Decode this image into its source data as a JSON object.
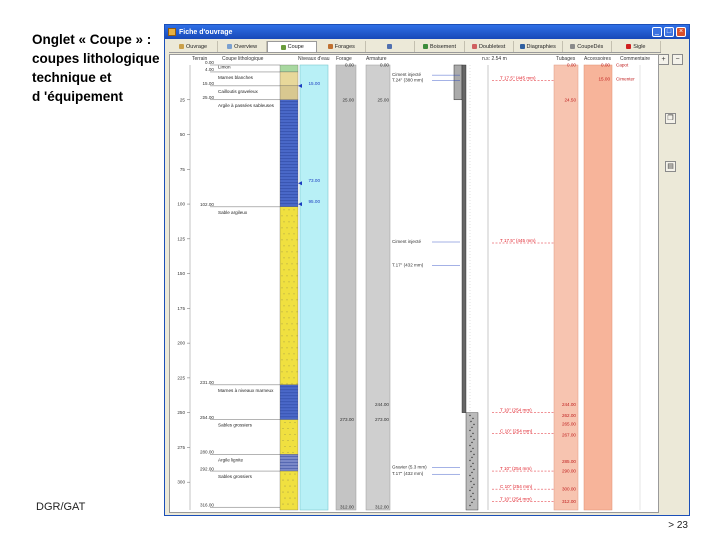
{
  "caption": {
    "lines": [
      "Onglet « Coupe » :",
      "coupes lithologique",
      "technique et",
      "d 'équipement"
    ]
  },
  "footer": {
    "left": "DGR/GAT",
    "right": "> 23"
  },
  "window": {
    "title": "Fiche d'ouvrage",
    "controls": [
      "minimize-icon",
      "maximize-icon",
      "close-icon"
    ],
    "tabs": [
      {
        "label": "Ouvrage",
        "icon": "folder-icon",
        "color": "#caa04a"
      },
      {
        "label": "Overview",
        "icon": "grid-icon",
        "color": "#7aa0d0"
      },
      {
        "label": "Coupe",
        "icon": "coupe-icon",
        "color": "#6a9c3c",
        "active": true
      },
      {
        "label": "Forages",
        "icon": "drill-icon",
        "color": "#c07030"
      },
      {
        "label": "",
        "icon": "table-icon",
        "color": "#5070b0"
      },
      {
        "label": "Boisement",
        "icon": "tree-icon",
        "color": "#3c8c3c"
      },
      {
        "label": "Doubletest",
        "icon": "chart-icon",
        "color": "#d06060"
      },
      {
        "label": "Diagraphies",
        "icon": "curve-icon",
        "color": "#3060a0"
      },
      {
        "label": "CoupeDés",
        "icon": "section-icon",
        "color": "#8a8a8a"
      },
      {
        "label": "Sigle",
        "icon": "plus-icon",
        "color": "#d02020"
      }
    ],
    "side_buttons": [
      "zoom-in-icon",
      "zoom-out-icon",
      "copy-icon",
      "print-icon"
    ]
  },
  "section": {
    "headers": {
      "terrain": "Terrain",
      "coupe": "Coupe lithologique",
      "niveau": "Niveaux d'eau",
      "forage": "Forage",
      "armature": "Armature",
      "nivel": "n.s: 2.54 m",
      "tubages": "Tubages",
      "accessoires": "Accessoires",
      "commentaire": "Commentaire"
    },
    "depth_max": 320,
    "depth_ticks": [
      25,
      50,
      75,
      100,
      125,
      150,
      175,
      200,
      225,
      250,
      275,
      300
    ],
    "layers": [
      {
        "from": 0,
        "to": 5,
        "label": "Limon",
        "fill": "#a8d8a0"
      },
      {
        "from": 5,
        "to": 15,
        "label": "Marnes blanches",
        "fill": "#e8d89a"
      },
      {
        "from": 15,
        "to": 25,
        "label": "Cailloutis graveleux",
        "fill": "#d8c890"
      },
      {
        "from": 25,
        "to": 102,
        "label": "Argile à passées sableuses",
        "fill": "#4a68c8"
      },
      {
        "from": 102,
        "to": 230,
        "label": "Sable argileux",
        "fill": "#f0e040"
      },
      {
        "from": 230,
        "to": 255,
        "label": "Marnes à niveaux marneux",
        "fill": "#4a68c8"
      },
      {
        "from": 255,
        "to": 280,
        "label": "Sables grossiers",
        "fill": "#f0e040"
      },
      {
        "from": 280,
        "to": 292,
        "label": "Argile lignite",
        "fill": "#7a88c8"
      },
      {
        "from": 292,
        "to": 320,
        "label": "Sables grossiers",
        "fill": "#f0e040"
      }
    ],
    "terrain_labels": [
      {
        "depth": 0,
        "text": "0.00"
      },
      {
        "depth": 5,
        "text": "4.00"
      },
      {
        "depth": 15,
        "text": "15.00"
      },
      {
        "depth": 25,
        "text": "25.00"
      },
      {
        "depth": 102,
        "text": "102.00"
      },
      {
        "depth": 230,
        "text": "231.00"
      },
      {
        "depth": 255,
        "text": "254.00"
      },
      {
        "depth": 280,
        "text": "280.00"
      },
      {
        "depth": 292,
        "text": "292.00"
      },
      {
        "depth": 318,
        "text": "316.00"
      }
    ],
    "water_levels": [
      {
        "depth": 15,
        "text": "15.00"
      },
      {
        "depth": 85,
        "text": "73.00"
      },
      {
        "depth": 100,
        "text": "95.00"
      }
    ],
    "forage_labels": [
      {
        "depth": 0,
        "text": "0.00"
      },
      {
        "depth": 25,
        "text": "25.00"
      },
      {
        "depth": 255,
        "text": "273.00"
      },
      {
        "depth": 318,
        "text": "312.00"
      }
    ],
    "armature_labels": [
      {
        "depth": 0,
        "text": "0.00"
      },
      {
        "depth": 25,
        "text": "25.00"
      },
      {
        "depth": 244,
        "text": "244.00"
      },
      {
        "depth": 255,
        "text": "273.00"
      },
      {
        "depth": 318,
        "text": "312.00"
      }
    ],
    "annotations": [
      {
        "depth": 8,
        "text": "Ciment injecté"
      },
      {
        "depth": 12,
        "text": "T.24\" (380 mm)"
      },
      {
        "depth": 128,
        "text": "Ciment injecté"
      },
      {
        "depth": 145,
        "text": "T.17\" (432 mm)"
      },
      {
        "depth": 290,
        "text": "Gravier (5.3 mm)"
      },
      {
        "depth": 295,
        "text": "T.17\" (432 mm)"
      }
    ],
    "red_labels": [
      {
        "depth": 11,
        "text": "T 17.5\" (445 mm)"
      },
      {
        "depth": 128,
        "text": "T 17.5\" (445 mm)"
      },
      {
        "depth": 250,
        "text": "T 10\" (254 mm)"
      },
      {
        "depth": 265,
        "text": "C 10\" (254 mm)"
      },
      {
        "depth": 292,
        "text": "T 10\" (254 mm)"
      },
      {
        "depth": 305,
        "text": "C 10\" (254 mm)"
      },
      {
        "depth": 314,
        "text": "T 10\" (254 mm)"
      }
    ],
    "tubage_labels": [
      {
        "depth": 0,
        "text": "0.00"
      },
      {
        "depth": 25,
        "text": "24.50"
      },
      {
        "depth": 244,
        "text": "244.00"
      },
      {
        "depth": 252,
        "text": "262.00"
      },
      {
        "depth": 258,
        "text": "265.00"
      },
      {
        "depth": 266,
        "text": "267.00"
      },
      {
        "depth": 285,
        "text": "285.00"
      },
      {
        "depth": 292,
        "text": "290.00"
      },
      {
        "depth": 305,
        "text": "300.00"
      },
      {
        "depth": 314,
        "text": "312.00"
      }
    ],
    "accessoire_labels": [
      {
        "depth": 0,
        "text": "0.00"
      },
      {
        "depth": 10,
        "text": "15.00"
      }
    ],
    "comment_labels": [
      {
        "depth": 0,
        "text": "Capot"
      },
      {
        "depth": 10,
        "text": "Cimenter"
      }
    ]
  }
}
